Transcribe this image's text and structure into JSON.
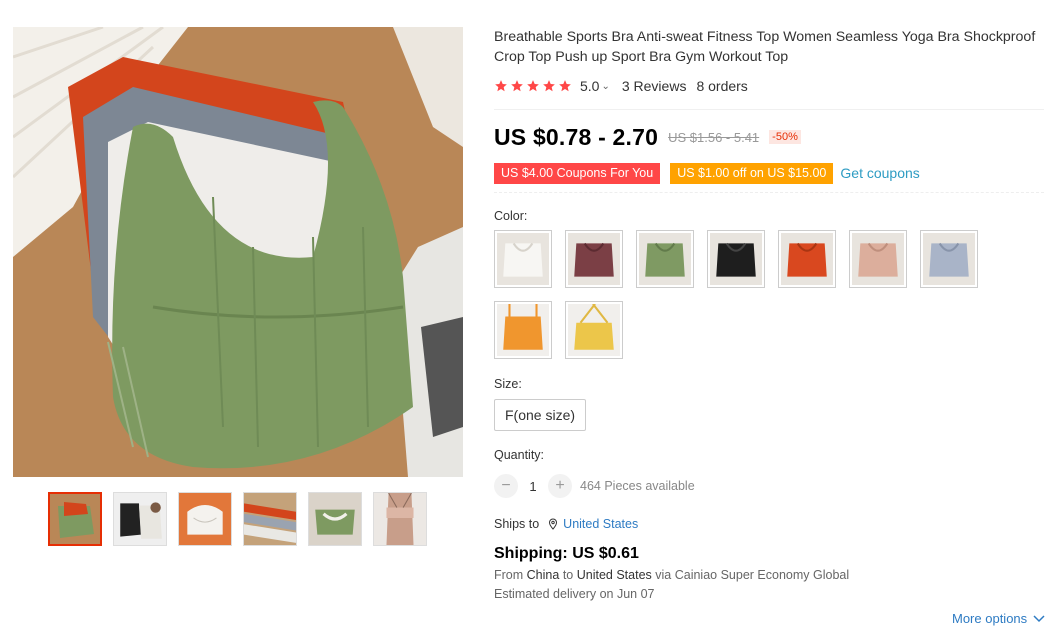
{
  "product": {
    "title": "Breathable Sports Bra Anti-sweat Fitness Top Women Seamless Yoga Bra Shockproof Crop Top Push up Sport Bra Gym Workout Top",
    "rating": "5.0",
    "reviews": "3 Reviews",
    "orders": "8 orders",
    "price": "US $0.78 - 2.70",
    "original_price": "US $1.56 - 5.41",
    "discount": "-50%"
  },
  "coupons": {
    "coupon1": "US $4.00 Coupons For You",
    "coupon2": "US $1.00 off on US $15.00",
    "get": "Get coupons"
  },
  "colors": {
    "label": "Color:",
    "swatches": [
      "white",
      "wine",
      "green",
      "black",
      "orange",
      "pink",
      "blue",
      "yellow-orange",
      "yellow"
    ],
    "hex": [
      "#f3f2ef",
      "#7b3f45",
      "#7f9a63",
      "#1e1e1e",
      "#d9481f",
      "#dcae9c",
      "#a9b4c8",
      "#f0962e",
      "#ecc64a"
    ]
  },
  "size": {
    "label": "Size:",
    "option": "F(one size)"
  },
  "quantity": {
    "label": "Quantity:",
    "value": "1",
    "minus": "−",
    "plus": "+",
    "available": "464 Pieces available"
  },
  "shipping": {
    "ships_to_label": "Ships to",
    "country": "United States",
    "price": "Shipping: US $0.61",
    "from_label": "From",
    "from": "China",
    "to_label": "to",
    "to": "United States",
    "via": "via Cainiao Super Economy Global",
    "estimated": "Estimated delivery on Jun 07",
    "more": "More options"
  },
  "gallery": {
    "thumbnails": [
      "green-top",
      "black-white-tops",
      "orange-open-top",
      "stacked-tops",
      "green-pair",
      "back-view"
    ]
  },
  "accent": {
    "red": "#ff4747",
    "orange": "#ffa200",
    "link": "#2e9cc3",
    "star": "#ff4747"
  }
}
